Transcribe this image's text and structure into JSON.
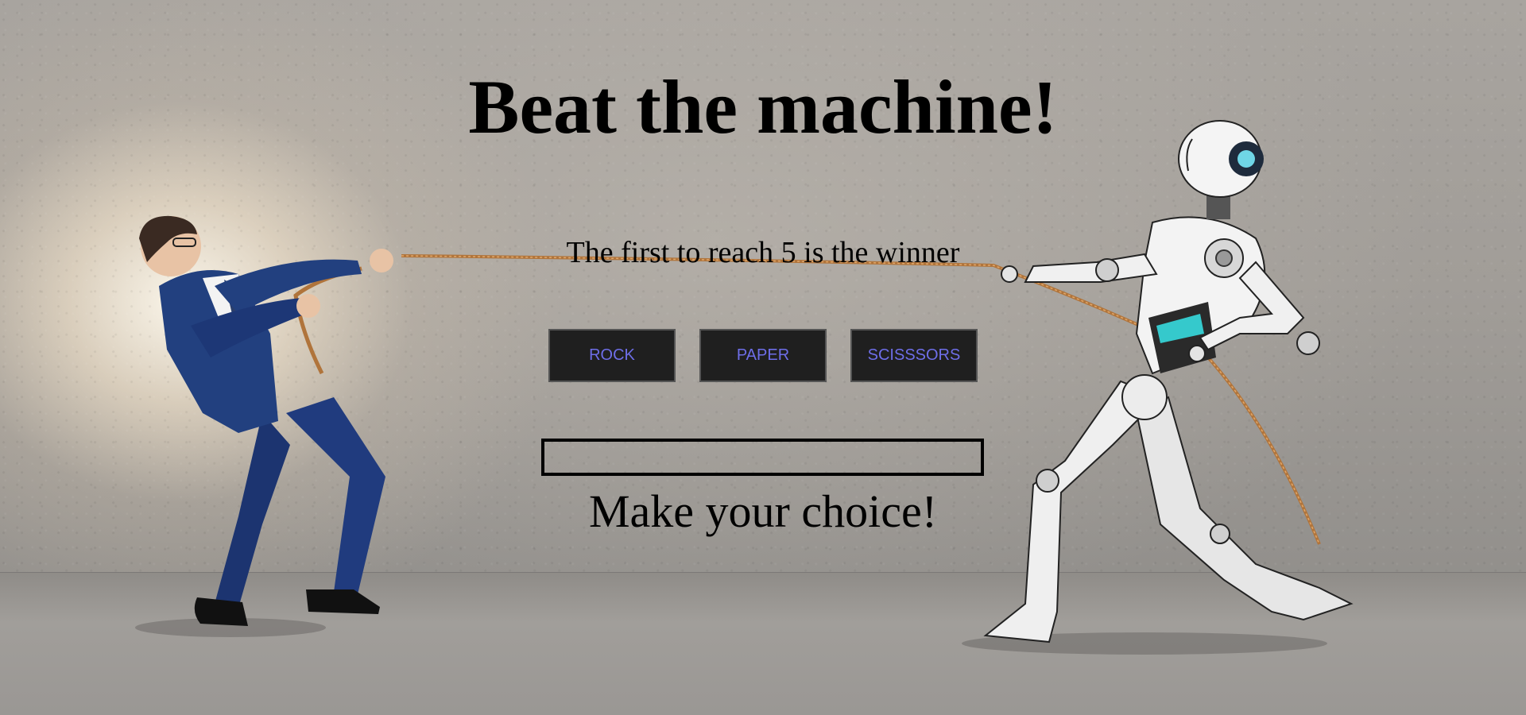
{
  "game": {
    "title": "Beat the machine!",
    "subtitle": "The first to reach 5 is the winner",
    "status": "Make your choice!",
    "result": ""
  },
  "choices": [
    {
      "label": "ROCK"
    },
    {
      "label": "PAPER"
    },
    {
      "label": "SCISSSORS"
    }
  ],
  "colors": {
    "button_bg": "#1f1f1f",
    "button_text": "#6e6ee8",
    "text": "#000000"
  },
  "illustration": {
    "left_figure": "businessman-pulling-rope",
    "right_figure": "humanoid-robot-pulling-rope"
  }
}
